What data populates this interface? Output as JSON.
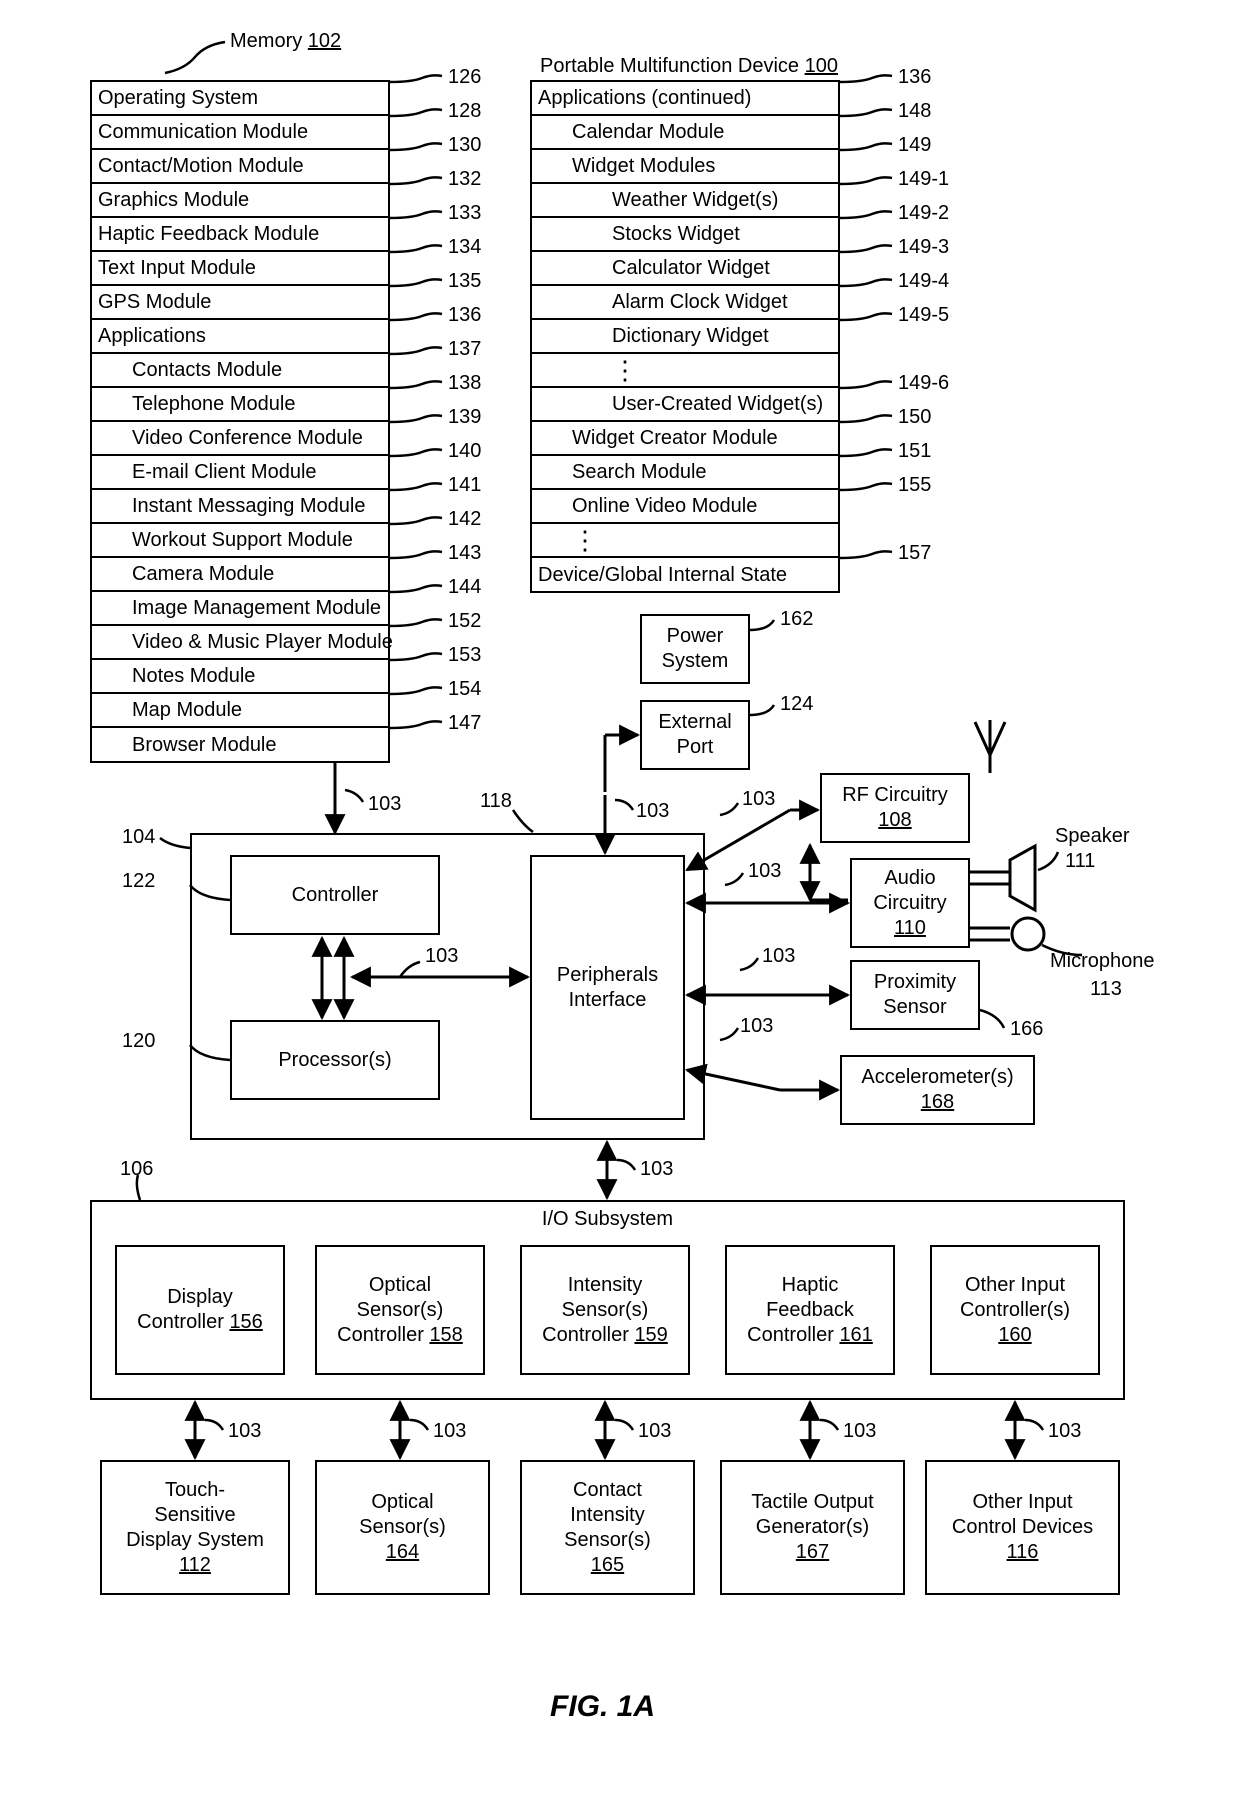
{
  "figure_label": "FIG. 1A",
  "titles": {
    "memory": "Memory",
    "memory_ref": "102",
    "device": "Portable Multifunction Device",
    "device_ref": "100"
  },
  "memory_rows": [
    {
      "t": "Operating System",
      "r": "126"
    },
    {
      "t": "Communication Module",
      "r": "128"
    },
    {
      "t": "Contact/Motion Module",
      "r": "130"
    },
    {
      "t": "Graphics Module",
      "r": "132"
    },
    {
      "t": "Haptic Feedback Module",
      "r": "133"
    },
    {
      "t": "Text Input Module",
      "r": "134"
    },
    {
      "t": "GPS Module",
      "r": "135"
    },
    {
      "t": "Applications",
      "r": "136"
    },
    {
      "t": "Contacts Module",
      "r": "137",
      "i": 1
    },
    {
      "t": "Telephone Module",
      "r": "138",
      "i": 1
    },
    {
      "t": "Video Conference Module",
      "r": "139",
      "i": 1
    },
    {
      "t": "E-mail Client Module",
      "r": "140",
      "i": 1
    },
    {
      "t": "Instant Messaging Module",
      "r": "141",
      "i": 1
    },
    {
      "t": "Workout Support Module",
      "r": "142",
      "i": 1
    },
    {
      "t": "Camera Module",
      "r": "143",
      "i": 1
    },
    {
      "t": "Image Management Module",
      "r": "144",
      "i": 1
    },
    {
      "t": "Video & Music Player Module",
      "r": "152",
      "i": 1
    },
    {
      "t": "Notes Module",
      "r": "153",
      "i": 1
    },
    {
      "t": "Map Module",
      "r": "154",
      "i": 1
    },
    {
      "t": "Browser Module",
      "r": "147",
      "i": 1
    }
  ],
  "apps_cont_rows": [
    {
      "t": "Applications (continued)",
      "r": "136"
    },
    {
      "t": "Calendar Module",
      "r": "148",
      "i": 1
    },
    {
      "t": "Widget Modules",
      "r": "149",
      "i": 1
    },
    {
      "t": "Weather Widget(s)",
      "r": "149-1",
      "i": 2
    },
    {
      "t": "Stocks Widget",
      "r": "149-2",
      "i": 2
    },
    {
      "t": "Calculator Widget",
      "r": "149-3",
      "i": 2
    },
    {
      "t": "Alarm Clock Widget",
      "r": "149-4",
      "i": 2
    },
    {
      "t": "Dictionary Widget",
      "r": "149-5",
      "i": 2
    },
    {
      "t": "⋮",
      "r": "",
      "i": 2,
      "dots": true
    },
    {
      "t": "User-Created Widget(s)",
      "r": "149-6",
      "i": 2
    },
    {
      "t": "Widget Creator Module",
      "r": "150",
      "i": 1
    },
    {
      "t": "Search Module",
      "r": "151",
      "i": 1
    },
    {
      "t": "Online Video Module",
      "r": "155",
      "i": 1
    },
    {
      "t": "⋮",
      "r": "",
      "i": 1,
      "dots": true
    },
    {
      "t": "Device/Global Internal State",
      "r": "157"
    }
  ],
  "blocks": {
    "power": {
      "t": "Power\nSystem",
      "r": "162"
    },
    "ext_port": {
      "t": "External\nPort",
      "r": "124"
    },
    "rf": {
      "t": "RF Circuitry",
      "u": "108"
    },
    "audio": {
      "t": "Audio\nCircuitry",
      "u": "110"
    },
    "prox": {
      "t": "Proximity\nSensor",
      "r": "166"
    },
    "accel": {
      "t": "Accelerometer(s)",
      "u": "168"
    },
    "controller": {
      "t": "Controller"
    },
    "processor": {
      "t": "Processor(s)"
    },
    "periph": {
      "t": "Peripherals\nInterface"
    },
    "io": {
      "t": "I/O Subsystem"
    },
    "disp_ctl": {
      "t": "Display\nController ",
      "u": "156"
    },
    "opt_ctl": {
      "t": "Optical\nSensor(s)\nController ",
      "u": "158"
    },
    "int_ctl": {
      "t": "Intensity\nSensor(s)\nController ",
      "u": "159"
    },
    "hap_ctl": {
      "t": "Haptic\nFeedback\nController ",
      "u": "161"
    },
    "oth_ctl": {
      "t": "Other Input\nController(s)",
      "u": "160"
    },
    "touch": {
      "t": "Touch-\nSensitive\nDisplay System",
      "u": "112"
    },
    "opt_s": {
      "t": "Optical\nSensor(s)",
      "u": "164"
    },
    "cont_s": {
      "t": "Contact\nIntensity\nSensor(s)",
      "u": "165"
    },
    "tact": {
      "t": "Tactile Output\nGenerator(s)",
      "u": "167"
    },
    "oth_d": {
      "t": "Other Input\nControl Devices",
      "u": "116"
    }
  },
  "labels": {
    "speaker": "Speaker",
    "speaker_ref": "111",
    "mic": "Microphone",
    "mic_ref": "113",
    "r103": "103",
    "r104": "104",
    "r122": "122",
    "r120": "120",
    "r106": "106",
    "r118": "118"
  }
}
